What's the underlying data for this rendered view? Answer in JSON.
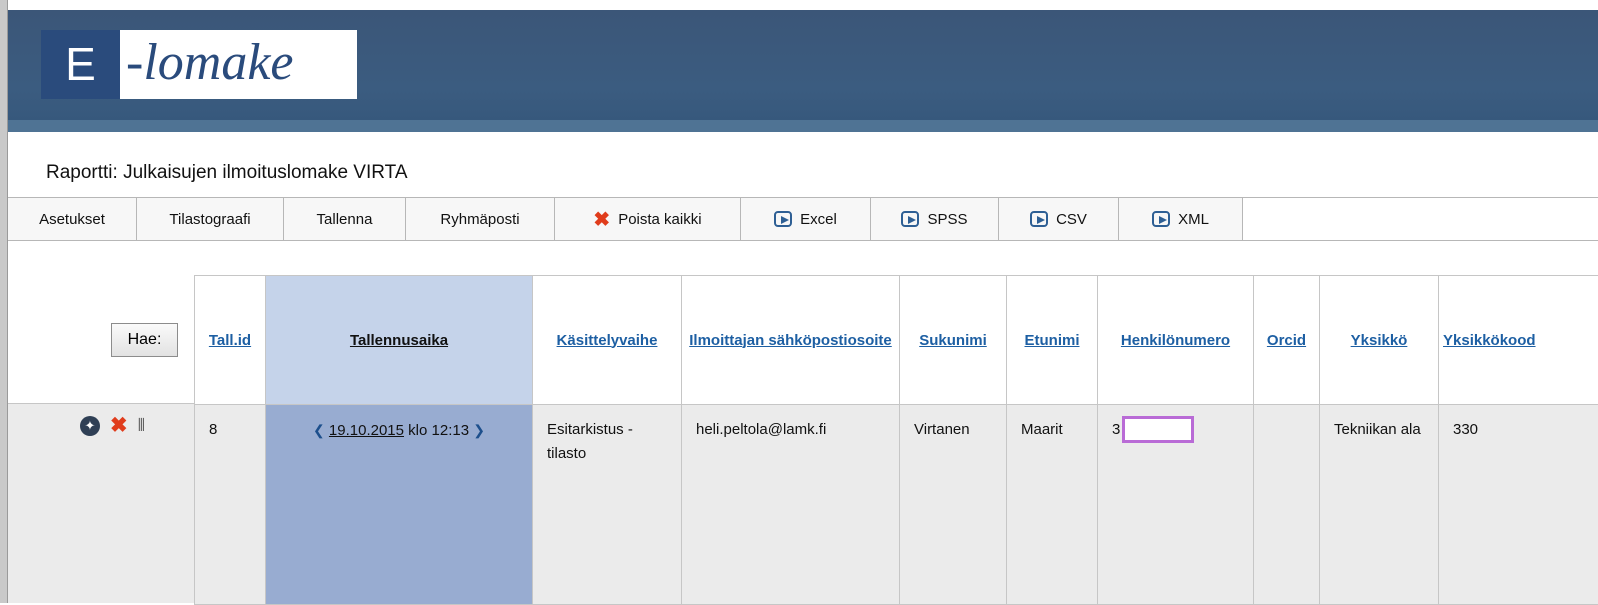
{
  "logo": {
    "letter": "E",
    "word": "-lomake"
  },
  "report_title": "Raportti: Julkaisujen ilmoituslomake VIRTA",
  "toolbar": {
    "settings": "Asetukset",
    "stats_graph": "Tilastograafi",
    "save": "Tallenna",
    "group_mail": "Ryhmäposti",
    "delete_all": "Poista kaikki",
    "excel": "Excel",
    "spss": "SPSS",
    "csv": "CSV",
    "xml": "XML"
  },
  "search_button": "Hae:",
  "columns": [
    "Tall.id",
    "Tallennusaika",
    "Käsittelyvaihe",
    "Ilmoittajan sähköpostiosoite",
    "Sukunimi",
    "Etunimi",
    "Henkilönumero",
    "Orcid",
    "Yksikkö",
    "Yksikkökood"
  ],
  "row": {
    "id": "8",
    "date": "19.10.2015",
    "time": "klo 12:13",
    "stage": "Esitarkistus - tilasto",
    "email": "heli.peltola@lamk.fi",
    "surname": "Virtanen",
    "firstname": "Maarit",
    "person_number_prefix": "3",
    "orcid": "",
    "unit": "Tekniikan ala",
    "unit_code": "330"
  },
  "colors": {
    "header": "#3b5678",
    "selected_header": "#c5d3ea",
    "selected_cell": "#98acd1",
    "redaction": "#b96bd6"
  }
}
